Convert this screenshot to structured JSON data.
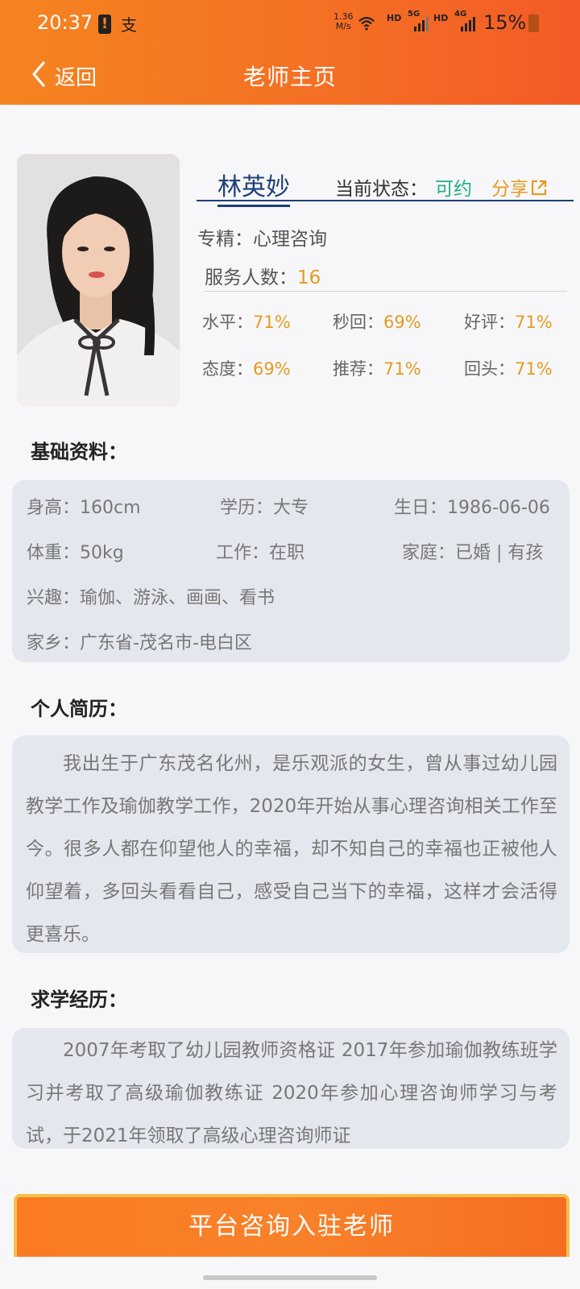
{
  "status_bar": {
    "time": "20:37",
    "alert": "!",
    "app_glyph": "支",
    "speed_value": "1.36",
    "speed_unit": "M/s",
    "hd1": "HD",
    "net1": "5G",
    "hd2": "HD",
    "net2": "4G",
    "battery": "15%"
  },
  "nav": {
    "back_label": "返回",
    "title": "老师主页"
  },
  "profile": {
    "name": "林英妙",
    "state_label": "当前状态：",
    "state_value": "可约",
    "share_label": "分享",
    "specialty_label": "专精：",
    "specialty": "心理咨询",
    "served_label": "服务人数：",
    "served_count": "16",
    "stats": [
      {
        "label": "水平：",
        "value": "71%"
      },
      {
        "label": "秒回：",
        "value": "69%"
      },
      {
        "label": "好评：",
        "value": "71%"
      },
      {
        "label": "态度：",
        "value": "69%"
      },
      {
        "label": "推荐：",
        "value": "71%"
      },
      {
        "label": "回头：",
        "value": "71%"
      }
    ]
  },
  "basic": {
    "title": "基础资料：",
    "height": "身高：160cm",
    "education": "学历：大专",
    "birthday": "生日：1986-06-06",
    "weight": "体重：50kg",
    "work": "工作：在职",
    "family": "家庭：已婚 | 有孩",
    "hobbies": "兴趣：瑜伽、游泳、画画、看书",
    "hometown": "家乡：广东省-茂名市-电白区"
  },
  "resume": {
    "title": "个人简历：",
    "text": "我出生于广东茂名化州，是乐观派的女生，曾从事过幼儿园教学工作及瑜伽教学工作，2020年开始从事心理咨询相关工作至今。很多人都在仰望他人的幸福，却不知自己的幸福也正被他人仰望着，多回头看看自己，感受自己当下的幸福，这样才会活得更喜乐。"
  },
  "study": {
    "title": "求学经历：",
    "text": "2007年考取了幼儿园教师资格证 2017年参加瑜伽教练班学习并考取了高级瑜伽教练证 2020年参加心理咨询师学习与考试，于2021年领取了高级心理咨询师证"
  },
  "cta": {
    "label": "平台咨询入驻老师"
  },
  "colors": {
    "header_orange": "#f46e24",
    "accent_gold": "#e39b1e",
    "status_green": "#1fae85",
    "name_blue": "#1e3f78"
  }
}
